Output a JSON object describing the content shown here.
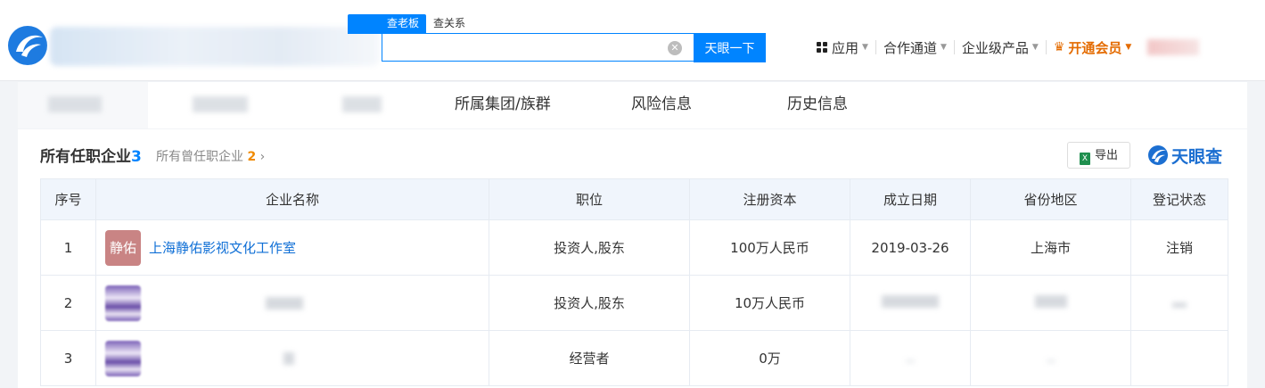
{
  "header": {
    "search_tabs": [
      "查老板",
      "查关系"
    ],
    "search_button": "天眼一下",
    "nav": [
      {
        "label": "应用",
        "icon": "grid-icon"
      },
      {
        "label": "合作通道"
      },
      {
        "label": "企业级产品"
      },
      {
        "label": "开通会员",
        "icon": "crown-icon"
      }
    ]
  },
  "subtabs": [
    "所属集团/族群",
    "风险信息",
    "历史信息"
  ],
  "section": {
    "title": "所有任职企业",
    "count": "3",
    "sub_label": "所有曾任职企业",
    "sub_count": "2",
    "export_label": "导出",
    "brand": "天眼查"
  },
  "table": {
    "columns": [
      "序号",
      "企业名称",
      "职位",
      "注册资本",
      "成立日期",
      "省份地区",
      "登记状态"
    ],
    "rows": [
      {
        "index": "1",
        "logo": "静佑",
        "name": "上海静佑影视文化工作室",
        "position": "投资人,股东",
        "capital": "100万人民币",
        "date": "2019-03-26",
        "region": "上海市",
        "status": "注销"
      },
      {
        "index": "2",
        "logo": "",
        "name": "",
        "position": "投资人,股东",
        "capital": "10万人民币",
        "date": "",
        "region": "",
        "status": ""
      },
      {
        "index": "3",
        "logo": "",
        "name": "",
        "position": "经营者",
        "capital": "0万",
        "date": "",
        "region": "",
        "status": ""
      }
    ]
  },
  "colors": {
    "accent": "#0084ff",
    "vip": "#e46b00",
    "status_cancelled": "#e6453e"
  }
}
